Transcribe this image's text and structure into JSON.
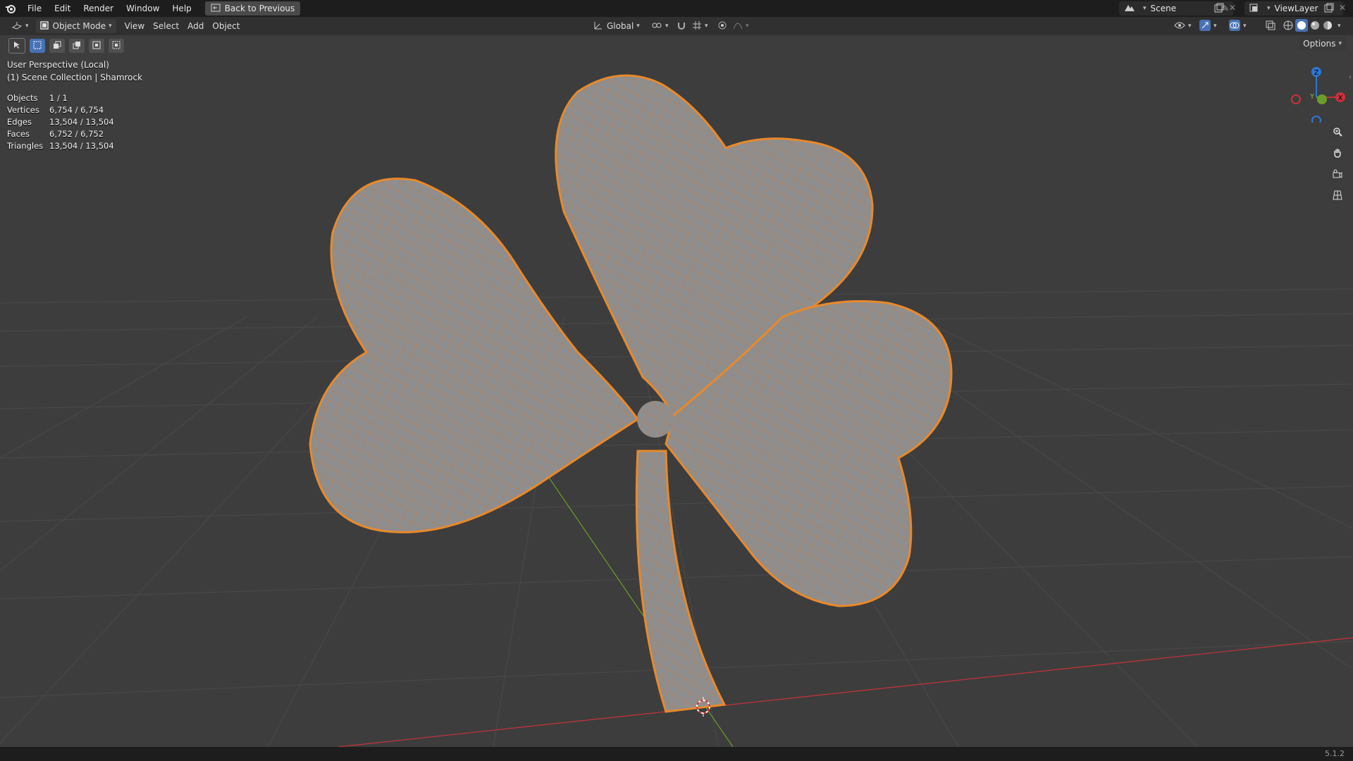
{
  "topbar": {
    "menus": [
      "File",
      "Edit",
      "Render",
      "Window",
      "Help"
    ],
    "back_button": "Back to Previous",
    "scene_name": "Scene",
    "view_layer": "ViewLayer"
  },
  "header": {
    "mode": "Object Mode",
    "menus": [
      "View",
      "Select",
      "Add",
      "Object"
    ],
    "orientation": "Global",
    "options_label": "Options"
  },
  "viewport": {
    "perspective_label": "User Perspective (Local)",
    "collection_label": "(1) Scene Collection | Shamrock",
    "stats": [
      {
        "label": "Objects",
        "value": "1 / 1"
      },
      {
        "label": "Vertices",
        "value": "6,754 / 6,754"
      },
      {
        "label": "Edges",
        "value": "13,504 / 13,504"
      },
      {
        "label": "Faces",
        "value": "6,752 / 6,752"
      },
      {
        "label": "Triangles",
        "value": "13,504 / 13,504"
      }
    ],
    "gizmo": {
      "z": "Z",
      "y": "Y",
      "x": "X"
    }
  },
  "statusbar": {
    "version": "5.1.2"
  },
  "colors": {
    "selection": "#e8892b",
    "mesh": "#8d8d8d",
    "x_axis": "#c8323c",
    "y_axis": "#6a9e2a",
    "z_axis": "#2f78d6"
  }
}
